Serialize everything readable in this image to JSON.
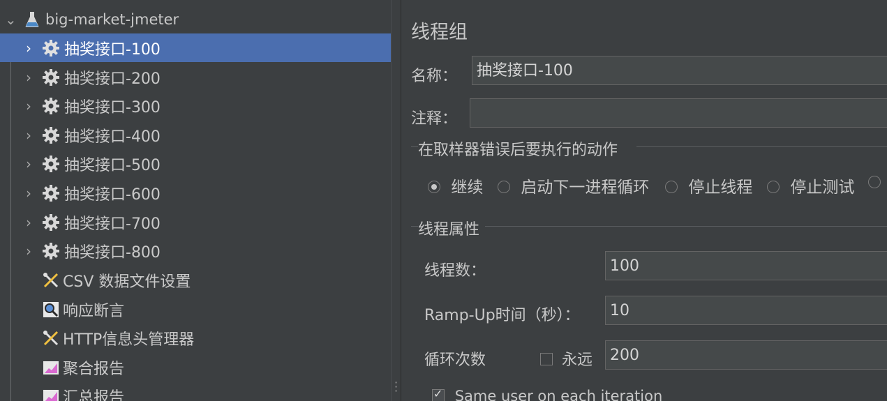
{
  "tree": {
    "root_label": "big-market-jmeter",
    "items": [
      {
        "label": "抽奖接口-100",
        "selected": true
      },
      {
        "label": "抽奖接口-200"
      },
      {
        "label": "抽奖接口-300"
      },
      {
        "label": "抽奖接口-400"
      },
      {
        "label": "抽奖接口-500"
      },
      {
        "label": "抽奖接口-600"
      },
      {
        "label": "抽奖接口-700"
      },
      {
        "label": "抽奖接口-800"
      },
      {
        "label": "CSV 数据文件设置"
      },
      {
        "label": "响应断言"
      },
      {
        "label": "HTTP信息头管理器"
      },
      {
        "label": "聚合报告"
      },
      {
        "label": "汇总报告"
      }
    ]
  },
  "editor": {
    "title": "线程组",
    "name_label": "名称：",
    "name_value": "抽奖接口-100",
    "comment_label": "注释：",
    "comment_value": "",
    "on_error_title": "在取样器错误后要执行的动作",
    "on_error_options": [
      {
        "label": "继续",
        "checked": true
      },
      {
        "label": "启动下一进程循环",
        "checked": false
      },
      {
        "label": "停止线程",
        "checked": false
      },
      {
        "label": "停止测试",
        "checked": false
      }
    ],
    "thread_props_title": "线程属性",
    "threads_label": "线程数：",
    "threads_value": "100",
    "rampup_label": "Ramp-Up时间（秒）：",
    "rampup_value": "10",
    "loop_label": "循环次数",
    "forever_label": "永远",
    "forever_checked": false,
    "loop_value": "200",
    "same_user_label": "Same user on each iteration",
    "same_user_checked": true
  },
  "colors": {
    "background": "#3c3f41",
    "selection": "#4b6eaf",
    "field_bg": "#45494a"
  }
}
